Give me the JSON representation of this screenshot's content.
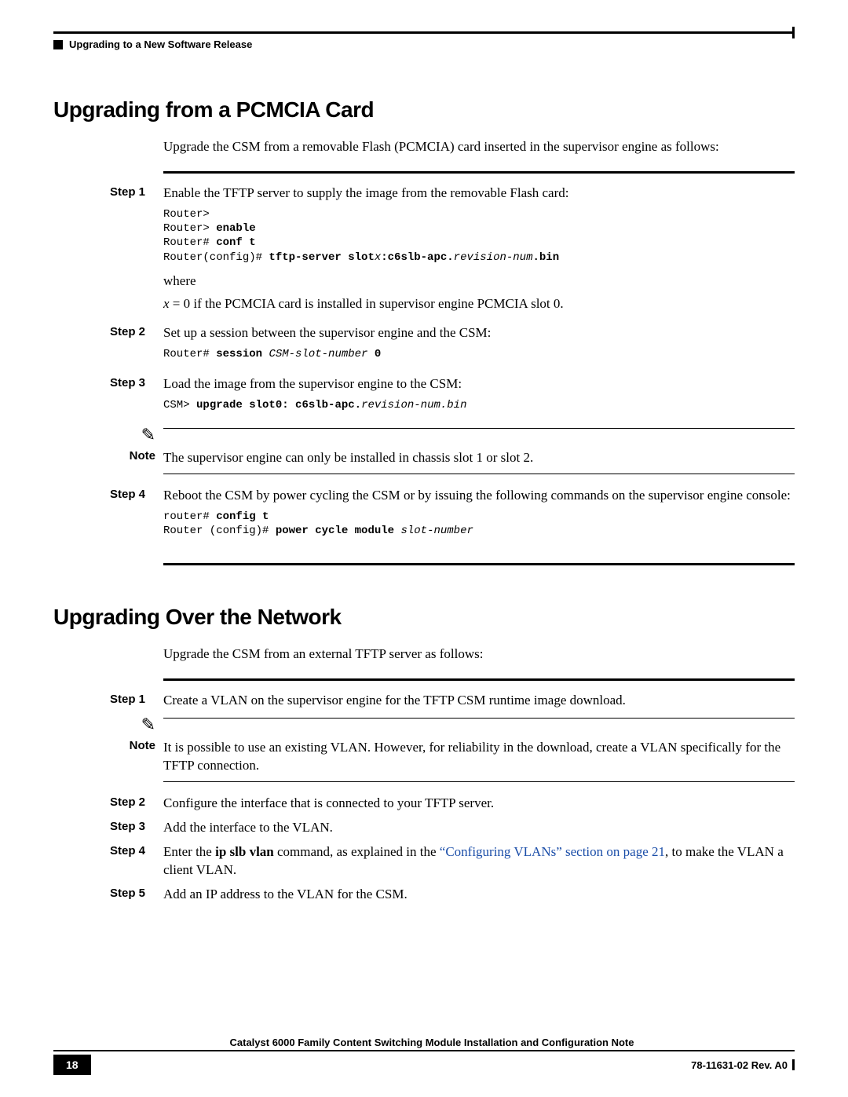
{
  "running_head": "Upgrading to a New Software Release",
  "section_a": {
    "title": "Upgrading from a PCMCIA Card",
    "intro": "Upgrade the CSM from a removable Flash (PCMCIA) card inserted in the supervisor engine as follows:",
    "step1": {
      "label": "Step 1",
      "text": "Enable the TFTP server to supply the image from the removable Flash card:",
      "code_l1": "Router>",
      "code_l2a": "Router> ",
      "code_l2b": "enable",
      "code_l3a": "Router# ",
      "code_l3b": "conf t",
      "code_l4a": "Router(config)# ",
      "code_l4b": "tftp-server slot",
      "code_l4c": "x",
      "code_l4d": ":c6slb-apc.",
      "code_l4e": "revision-num",
      "code_l4f": ".bin",
      "where": "where",
      "where2a": "x",
      "where2b": " = 0 if the PCMCIA card is installed in supervisor engine PCMCIA slot 0."
    },
    "step2": {
      "label": "Step 2",
      "text": "Set up a session between the supervisor engine and the CSM:",
      "code_a": "Router# ",
      "code_b": "session ",
      "code_c": "CSM-slot-number ",
      "code_d": "0"
    },
    "step3": {
      "label": "Step 3",
      "text": "Load the image from the supervisor engine to the CSM:",
      "code_a": "CSM> ",
      "code_b": "upgrade slot0: c6slb-apc.",
      "code_c": "revision-num.bin"
    },
    "note": {
      "label": "Note",
      "text": "The supervisor engine can only be installed in chassis slot 1 or slot 2."
    },
    "step4": {
      "label": "Step 4",
      "text": "Reboot the CSM by power cycling the CSM or by issuing the following commands on the supervisor engine console:",
      "code_l1a": "router# ",
      "code_l1b": "config t",
      "code_l2a": "Router (config)# ",
      "code_l2b": "power cycle module ",
      "code_l2c": "slot-number"
    }
  },
  "section_b": {
    "title": "Upgrading Over the Network",
    "intro": "Upgrade the CSM from an external TFTP server as follows:",
    "step1": {
      "label": "Step 1",
      "text": "Create a VLAN on the supervisor engine for the TFTP CSM runtime image download."
    },
    "note": {
      "label": "Note",
      "text": "It is possible to use an existing VLAN. However, for reliability in the download, create a VLAN specifically for the TFTP connection."
    },
    "step2": {
      "label": "Step 2",
      "text": "Configure the interface that is connected to your TFTP server."
    },
    "step3": {
      "label": "Step 3",
      "text": "Add the interface to the VLAN."
    },
    "step4": {
      "label": "Step 4",
      "pre": "Enter the ",
      "cmd": "ip slb vlan",
      "mid": " command, as explained in the ",
      "link": "“Configuring VLANs” section on page 21",
      "post": ", to make the VLAN a client VLAN."
    },
    "step5": {
      "label": "Step 5",
      "text": "Add an IP address to the VLAN for the CSM."
    }
  },
  "footer": {
    "title": "Catalyst 6000 Family Content Switching Module Installation and Configuration Note",
    "page": "18",
    "rev": "78-11631-02 Rev. A0"
  }
}
